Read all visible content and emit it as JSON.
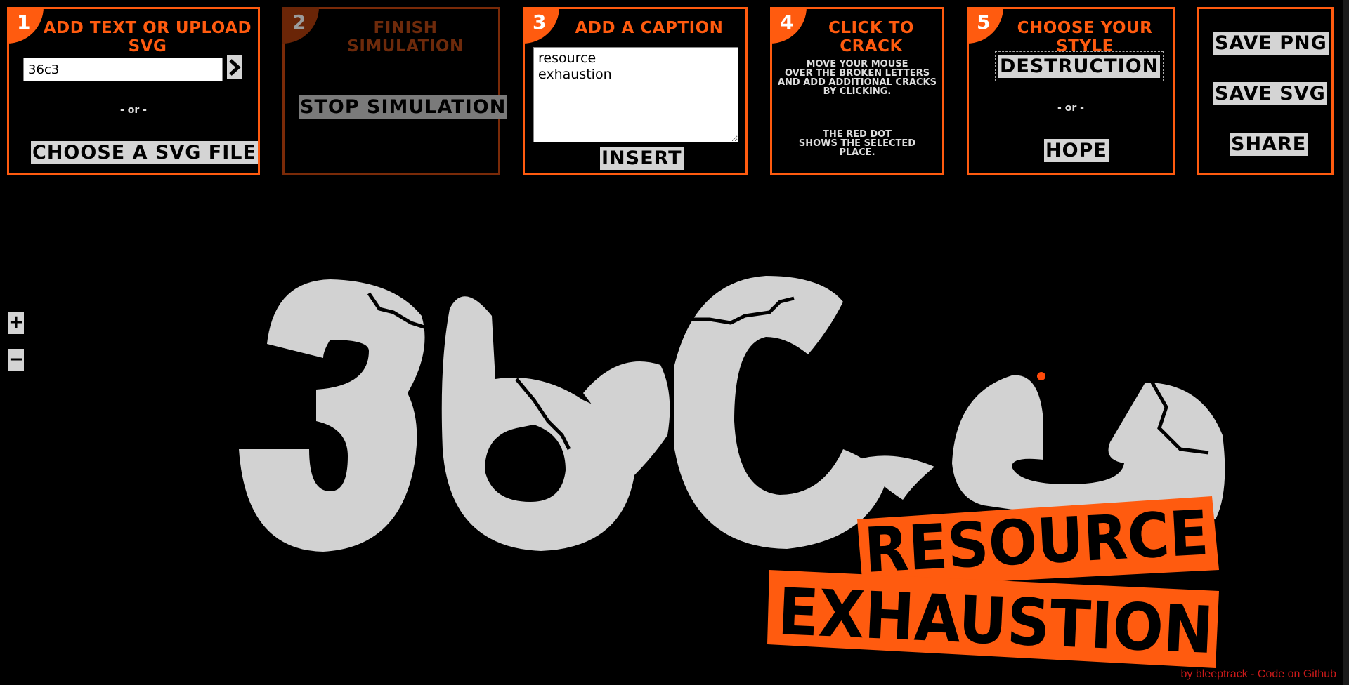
{
  "steps": {
    "step1": {
      "number": "1",
      "title": "Add text or upload SVG",
      "text_value": "36c3",
      "submit_icon": "chevron-right-icon",
      "or_label": "- or -",
      "file_button": "Choose a SVG file"
    },
    "step2": {
      "number": "2",
      "title": "Finish simulation",
      "stop_button": "Stop simulation"
    },
    "step3": {
      "number": "3",
      "title": "Add a caption",
      "caption_value": "resource\nexhaustion",
      "insert_button": "Insert"
    },
    "step4": {
      "number": "4",
      "title": "Click to crack",
      "help_line1": "Move your mouse",
      "help_line2": "over the broken letters",
      "help_line3": "and add additional cracks",
      "help_line4": "by clicking.",
      "dot_line1": "The red dot",
      "dot_line2": "shows the selected",
      "dot_line3": "place."
    },
    "step5": {
      "number": "5",
      "title": "Choose your style",
      "style1": "Destruction",
      "or_label": "- or -",
      "style2": "Hope"
    },
    "actions": {
      "save_png": "Save PNG",
      "save_svg": "Save SVG",
      "share": "Share"
    }
  },
  "zoom": {
    "zoom_in": "+",
    "zoom_out": "−"
  },
  "canvas": {
    "main_text": "36c3",
    "caption_line1": "RESOURCE",
    "caption_line2": "EXHAUSTION"
  },
  "colors": {
    "accent": "#ff5b0f",
    "letter_fill": "#d2d2d2",
    "background": "#000000",
    "selected_dot": "#ff4a0a"
  },
  "footer": {
    "credit": "by bleeptrack - Code on Github"
  }
}
